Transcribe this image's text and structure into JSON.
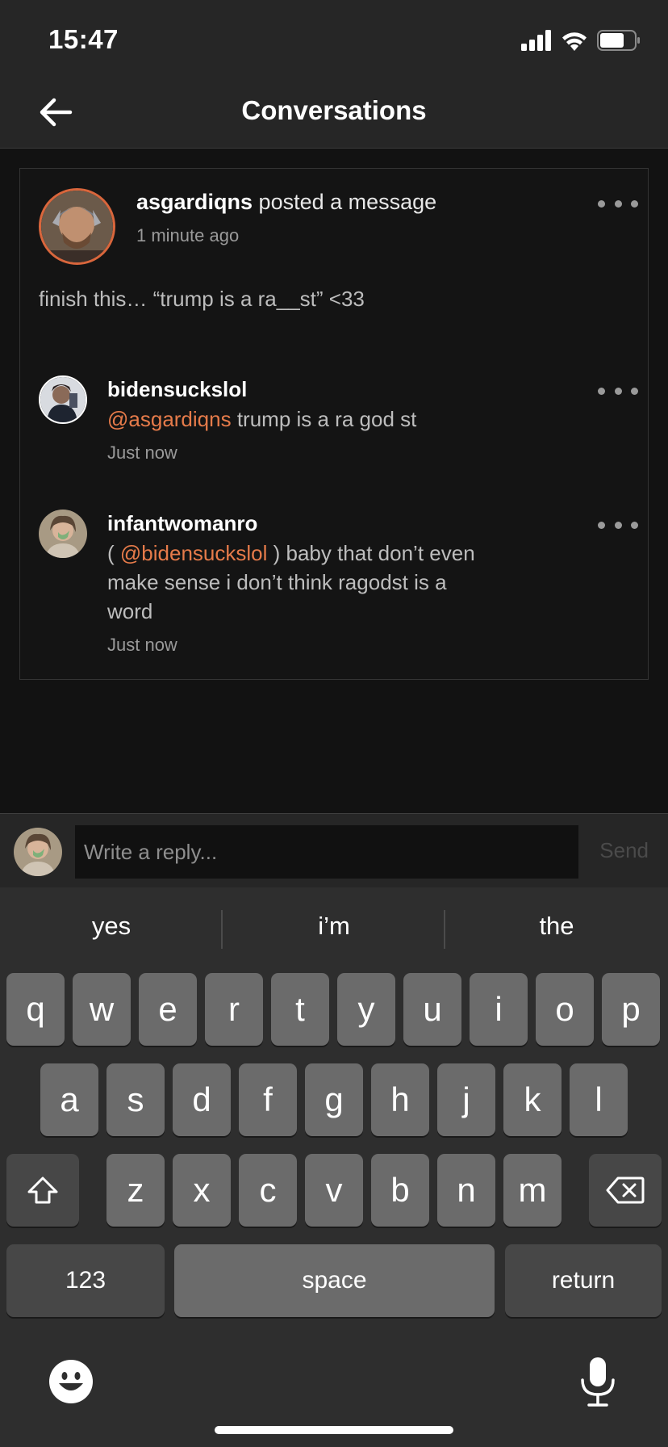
{
  "status_bar": {
    "time": "15:47"
  },
  "nav": {
    "title": "Conversations"
  },
  "post": {
    "username": "asgardiqns",
    "action": " posted a message",
    "time": "1 minute ago",
    "body": "finish this… “trump is a ra__st” <33"
  },
  "comments": [
    {
      "username": "bidensuckslol",
      "mention": "@asgardiqns",
      "text_prefix": "",
      "text": " trump is a ra god st",
      "time": "Just now"
    },
    {
      "username": "infantwomanro",
      "mention": "@bidensuckslol",
      "text_prefix": "( ",
      "text": " ) baby that don’t even make sense i don’t think ragodst is a word",
      "time": "Just now"
    }
  ],
  "reply": {
    "placeholder": "Write a reply...",
    "send_label": "Send"
  },
  "keyboard": {
    "suggestions": [
      "yes",
      "i’m",
      "the"
    ],
    "row1": [
      "q",
      "w",
      "e",
      "r",
      "t",
      "y",
      "u",
      "i",
      "o",
      "p"
    ],
    "row2": [
      "a",
      "s",
      "d",
      "f",
      "g",
      "h",
      "j",
      "k",
      "l"
    ],
    "row3": [
      "z",
      "x",
      "c",
      "v",
      "b",
      "n",
      "m"
    ],
    "numbers_label": "123",
    "space_label": "space",
    "return_label": "return"
  },
  "icons": {
    "back": "arrow-left-icon",
    "more": "more-dots-icon",
    "signal": "signal-icon",
    "wifi": "wifi-icon",
    "battery": "battery-icon",
    "shift": "shift-icon",
    "delete": "delete-icon",
    "emoji": "emoji-icon",
    "mic": "microphone-icon"
  },
  "colors": {
    "accent": "#e67b4a",
    "background": "#121212",
    "bar": "#262626"
  }
}
